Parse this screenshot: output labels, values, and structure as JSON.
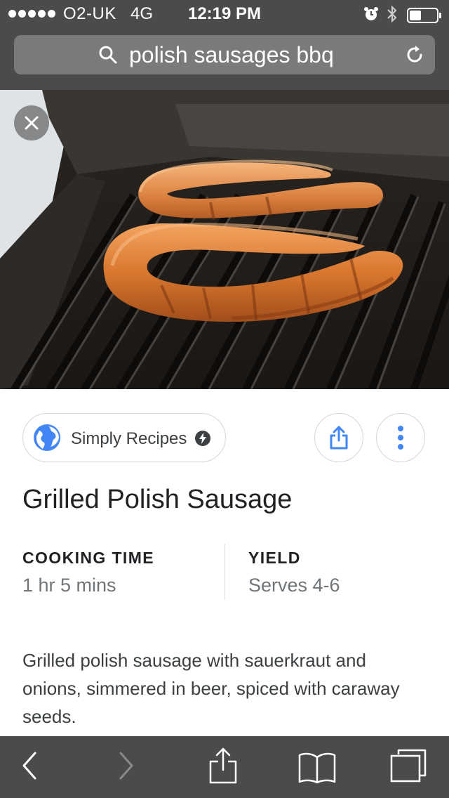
{
  "status_bar": {
    "carrier": "O2-UK",
    "network": "4G",
    "time": "12:19 PM"
  },
  "url_bar": {
    "query": "polish sausages bbq"
  },
  "source": {
    "name": "Simply Recipes"
  },
  "recipe": {
    "title": "Grilled Polish Sausage",
    "cooking_time_label": "COOKING TIME",
    "cooking_time_value": "1 hr 5 mins",
    "yield_label": "YIELD",
    "yield_value": "Serves 4-6",
    "description": "Grilled polish sausage with sauerkraut and onions, simmered in beer, spiced with caraway seeds."
  },
  "icons": {
    "search": "search-icon",
    "reload": "reload-icon",
    "close": "close-icon",
    "globe": "globe-icon",
    "amp": "amp-bolt-icon",
    "share": "share-icon",
    "more": "more-vertical-icon",
    "back": "chevron-left-icon",
    "forward": "chevron-right-icon",
    "bookmarks": "book-icon",
    "tabs": "tabs-icon"
  },
  "colors": {
    "chrome": "#4b4b4b",
    "url_field": "#7a7a7a",
    "accent_blue": "#4285f4"
  }
}
